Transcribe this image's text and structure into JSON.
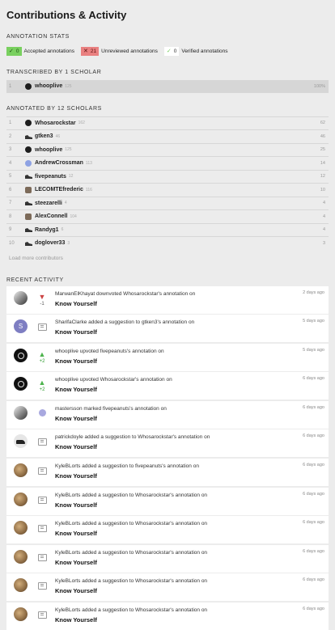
{
  "title": "Contributions & Activity",
  "stats": {
    "heading": "ANNOTATION STATS",
    "accepted": {
      "count": "0",
      "label": "Accepted annotations"
    },
    "unreviewed": {
      "count": "21",
      "label": "Unreviewed annotations"
    },
    "verified": {
      "count": "0",
      "label": "Verified annotations"
    }
  },
  "transcribed": {
    "heading": "TRANSCRIBED BY 1 SCHOLAR",
    "rows": [
      {
        "rank": "1",
        "name": "whooplive",
        "iq": "125",
        "value": "100%"
      }
    ]
  },
  "annotated": {
    "heading": "ANNOTATED BY 12 SCHOLARS",
    "rows": [
      {
        "rank": "1",
        "name": "Whosarockstar",
        "iq": "162",
        "value": "62"
      },
      {
        "rank": "2",
        "name": "gtken3",
        "iq": "46",
        "value": "46"
      },
      {
        "rank": "3",
        "name": "whooplive",
        "iq": "125",
        "value": "25"
      },
      {
        "rank": "4",
        "name": "AndrewCrossman",
        "iq": "113",
        "value": "14"
      },
      {
        "rank": "5",
        "name": "fivepeanuts",
        "iq": "12",
        "value": "12"
      },
      {
        "rank": "6",
        "name": "LECOMTEfrederic",
        "iq": "116",
        "value": "10"
      },
      {
        "rank": "7",
        "name": "steezarelli",
        "iq": "4",
        "value": "4"
      },
      {
        "rank": "8",
        "name": "AlexConnell",
        "iq": "104",
        "value": "4"
      },
      {
        "rank": "9",
        "name": "Randyg1",
        "iq": "6",
        "value": "4"
      },
      {
        "rank": "10",
        "name": "doglover33",
        "iq": "3",
        "value": "3"
      }
    ],
    "load_more": "Load more contributors"
  },
  "recent": {
    "heading": "RECENT ACTIVITY",
    "items": [
      {
        "text": "MarwanElKhayat downvoted Whosarockstar's annotation on",
        "song": "Know Yourself",
        "time": "2 days ago",
        "action": "-1"
      },
      {
        "text": "SharifaClarke added a suggestion to gtken3's annotation on",
        "song": "Know Yourself",
        "time": "5 days ago",
        "avatar_letter": "S"
      },
      {
        "text": "whooplive upvoted fivepeanuts's annotation on",
        "song": "Know Yourself",
        "time": "5 days ago",
        "action": "+2"
      },
      {
        "text": "whooplive upvoted Whosarockstar's annotation on",
        "song": "Know Yourself",
        "time": "6 days ago",
        "action": "+2"
      },
      {
        "text": "mastersson marked fivepeanuts's annotation on",
        "song": "Know Yourself",
        "time": "6 days ago"
      },
      {
        "text": "patrickdoyle added a suggestion to Whosarockstar's annotation on",
        "song": "Know Yourself",
        "time": "6 days ago"
      },
      {
        "text": "KyleBLorts added a suggestion to fivepeanuts's annotation on",
        "song": "Know Yourself",
        "time": "6 days ago"
      },
      {
        "text": "KyleBLorts added a suggestion to Whosarockstar's annotation on",
        "song": "Know Yourself",
        "time": "6 days ago"
      },
      {
        "text": "KyleBLorts added a suggestion to Whosarockstar's annotation on",
        "song": "Know Yourself",
        "time": "6 days ago"
      },
      {
        "text": "KyleBLorts added a suggestion to Whosarockstar's annotation on",
        "song": "Know Yourself",
        "time": "6 days ago"
      },
      {
        "text": "KyleBLorts added a suggestion to Whosarockstar's annotation on",
        "song": "Know Yourself",
        "time": "6 days ago"
      },
      {
        "text": "KyleBLorts added a suggestion to Whosarockstar's annotation on",
        "song": "Know Yourself",
        "time": "6 days ago"
      }
    ]
  }
}
